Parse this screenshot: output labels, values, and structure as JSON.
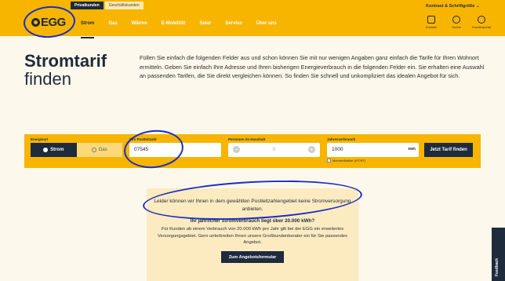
{
  "header": {
    "segments": [
      "Privatkunden",
      "Geschäftskunden"
    ],
    "logo_text": "EGG",
    "nav": [
      "Strom",
      "Gas",
      "Wärme",
      "E-Mobilität",
      "Solar",
      "Service",
      "Über uns"
    ],
    "contrast_label": "Kontrast & Schriftgröße",
    "icons": [
      {
        "icon": "chat-icon",
        "label": "Kontakt"
      },
      {
        "icon": "search-icon",
        "label": "Suche"
      },
      {
        "icon": "user-icon",
        "label": "Kundenportal"
      }
    ]
  },
  "hero": {
    "title_bold": "Stromtarif",
    "title_light": "finden",
    "intro": "Füllen Sie einfach die folgenden Felder aus und schon können Sie mit nur wenigen Angaben ganz einfach die Tarife für Ihren Wohnort ermitteln. Geben Sie einfach Ihre Adresse und Ihren bisherigen Energieverbrauch in die folgenden Felder ein. Sie erhalten eine Auswahl an passenden Tarifen, die Sie direkt vergleichen können. So finden Sie schnell und unkompliziert das idealen Angebot für sich."
  },
  "form": {
    "energy_label": "Energieart",
    "energy_options": [
      "Strom",
      "Gas"
    ],
    "plz_label": "Ihre Postleitzahl",
    "plz_value": "07545",
    "persons_label": "Personen im Haushalt",
    "persons_value": "0",
    "usage_label": "Jahresverbrauch",
    "usage_value": "1000",
    "usage_unit": "kWh",
    "checkbox_label": "Mehrtarifzähler (HT/NT)",
    "submit_label": "Jetzt Tarif finden"
  },
  "message": {
    "text": "Leider können wir Ihnen in dem gewählten Postleitzahlengebiet keine Stromversorgung anbieten.",
    "heading": "Ihr jährlicher Stromverbrauch liegt über 20.000 kWh?",
    "body": "Für Kunden ab einem Verbrauch von 20.000 kWh pro Jahr gilt bei der EGG ein erweitertes Versorgungsgebiet. Gern unterbreiten Ihnen unsere Großkundenberater ein für Sie passendes Angebot.",
    "button_label": "Zum Angebotsformular"
  },
  "feedback_label": "Feedback",
  "colors": {
    "brand_yellow": "#f7b500",
    "navy": "#1e2b3c",
    "annotation_blue": "#1b2ec2"
  }
}
